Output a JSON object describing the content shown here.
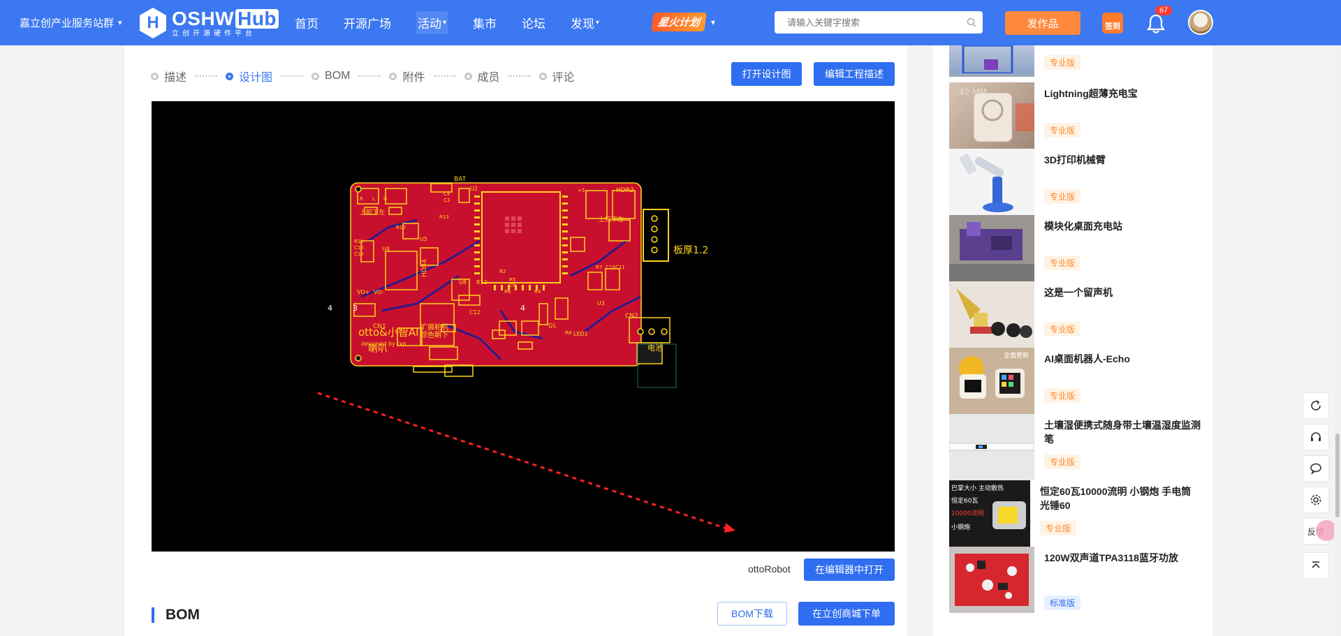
{
  "nav": {
    "org_selector": "嘉立创产业服务站群",
    "logo_brand": "OSHW",
    "logo_hub": "Hub",
    "logo_slogan": "立创开源硬件平台",
    "links": [
      "首页",
      "开源广场",
      "活动",
      "集市",
      "论坛",
      "发现"
    ],
    "spark_badge": "星火计划",
    "search_placeholder": "请输入关键字搜索",
    "publish_label": "发作品",
    "checkin_label": "签到",
    "notif_count": "67"
  },
  "project": {
    "steps": [
      {
        "label": "描述",
        "active": false
      },
      {
        "label": "设计图",
        "active": true
      },
      {
        "label": "BOM",
        "active": false
      },
      {
        "label": "附件",
        "active": false
      },
      {
        "label": "成员",
        "active": false
      },
      {
        "label": "评论",
        "active": false
      }
    ],
    "open_design_label": "打开设计图",
    "edit_desc_label": "编辑工程描述",
    "pcb": {
      "board_label": "otto&小智AI",
      "designer_label": "designed by txp",
      "thickness_label": "板厚1.2",
      "silk_labels": [
        "扩展舵机",
        "棕色朝下",
        "喇叭",
        "电池",
        "上舵下左",
        "上舵下左",
        "HDR4",
        "HDR2",
        "CN1",
        "CN2",
        "BAT",
        "U2",
        "U4",
        "U5",
        "U8",
        "U3",
        "LED1",
        "R12",
        "C12",
        "Q1",
        "VO+",
        "VO-",
        "R11",
        "C16",
        "C15",
        "R10",
        "C4",
        "C3",
        "R13",
        "R2",
        "R4",
        "R5",
        "R6",
        "R7",
        "R8",
        "C9",
        "C10",
        "C11",
        "R",
        "L",
        "G",
        "+5",
        "4",
        "3",
        "4"
      ]
    },
    "file_name": "ottoRobot",
    "open_in_editor_label": "在编辑器中打开",
    "bom_title": "BOM",
    "bom_download_label": "BOM下载",
    "order_label": "在立创商城下单"
  },
  "sidebar": {
    "top_tag": "专业版",
    "cards": [
      {
        "title": "Lightning超薄充电宝",
        "tag": "专业版",
        "tag_type": "pro"
      },
      {
        "title": "3D打印机械臂",
        "tag": "专业版",
        "tag_type": "pro"
      },
      {
        "title": "模块化桌面充电站",
        "tag": "专业版",
        "tag_type": "pro"
      },
      {
        "title": "这是一个留声机",
        "tag": "专业版",
        "tag_type": "pro"
      },
      {
        "title": "AI桌面机器人-Echo",
        "tag": "专业版",
        "tag_type": "pro"
      },
      {
        "title": "土壤湿便携式随身带土壤温湿度监测笔",
        "tag": "专业版",
        "tag_type": "pro"
      },
      {
        "title": "恒定60瓦10000流明 小钢炮 手电筒光锤60",
        "tag": "专业版",
        "tag_type": "pro"
      },
      {
        "title": "120W双声道TPA3118蓝牙功放",
        "tag": "标准版",
        "tag_type": "std"
      }
    ],
    "thumb_texts": {
      "lightning": "42 MM",
      "flashlight": [
        "巴掌大小 主动散热",
        "恒定60瓦",
        "10000流明",
        "小钢炮"
      ],
      "echo_screen": "全面更新"
    }
  },
  "float_tools": {
    "feedback_label": "反馈",
    "icons": [
      "refresh-icon",
      "headset-icon",
      "chat-icon",
      "settings-icon",
      "back-to-top-icon"
    ]
  },
  "colors": {
    "primary": "#3b78f2",
    "button_blue": "#2f6ef0",
    "orange": "#ff8a3d",
    "pcb_red": "#c8102e",
    "pcb_silk": "#ffd21f"
  }
}
